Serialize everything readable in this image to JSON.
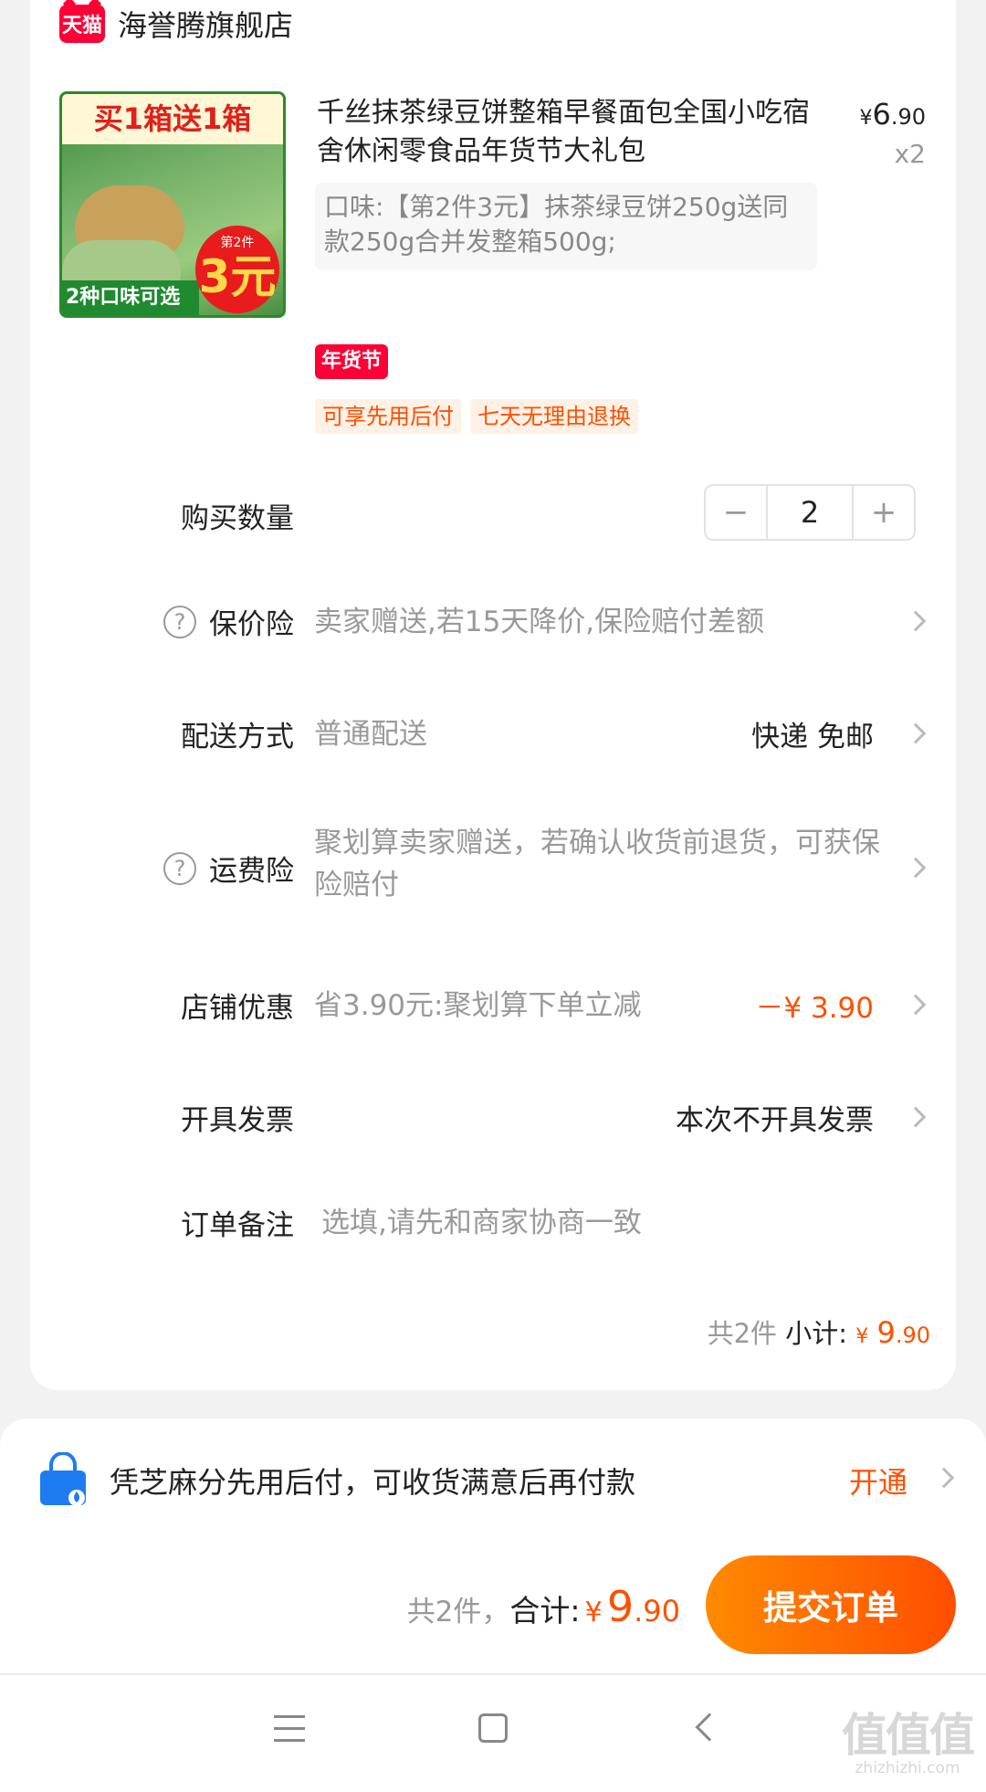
{
  "shop": {
    "badge": "天猫",
    "name": "海誉腾旗舰店"
  },
  "product": {
    "image": {
      "banner": "买1箱送1箱",
      "bottom_label": "2种口味可选",
      "burst_small": "第2件",
      "burst_big": "3元"
    },
    "title": "千丝抹茶绿豆饼整箱早餐面包全国小吃宿舍休闲零食品年货节大礼包",
    "price_symbol": "¥",
    "price_int": "6",
    "price_dec": ".90",
    "qty": "x2",
    "sku": "口味:【第2件3元】抹茶绿豆饼250g送同款250g合并发整箱500g;",
    "promo_tag": "年货节",
    "service_tags": [
      "可享先用后付",
      "七天无理由退换"
    ]
  },
  "quantity": {
    "label": "购买数量",
    "minus": "−",
    "value": "2",
    "plus": "+"
  },
  "price_protection": {
    "help_icon": "question-icon",
    "label": "保价险",
    "desc": "卖家赠送,若15天降价,保险赔付差额"
  },
  "delivery": {
    "label": "配送方式",
    "desc": "普通配送",
    "value": "快递 免邮"
  },
  "shipping_insurance": {
    "help_icon": "question-icon",
    "label": "运费险",
    "desc": "聚划算卖家赠送，若确认收货前退货，可获保险赔付"
  },
  "shop_discount": {
    "label": "店铺优惠",
    "desc": "省3.90元:聚划算下单立减",
    "value": "－¥ 3.90"
  },
  "invoice": {
    "label": "开具发票",
    "value": "本次不开具发票"
  },
  "note": {
    "label": "订单备注",
    "placeholder": "选填,请先和商家协商一致"
  },
  "subtotal": {
    "count": "共2件",
    "label": "小计:",
    "symbol": "¥",
    "int": "9",
    "dec": ".90"
  },
  "credit": {
    "icon": "shopping-bag-icon",
    "text": "凭芝麻分先用后付，可收货满意后再付款",
    "action": "开通"
  },
  "footer": {
    "count": "共2件，",
    "label": "合计:",
    "symbol": "¥",
    "int": "9",
    "dec": ".90",
    "submit": "提交订单"
  },
  "watermark": {
    "big": "值值值",
    "small": "zhizhizhi.com"
  },
  "colors": {
    "accent": "#ff5000",
    "tmall_red": "#ff0036"
  }
}
